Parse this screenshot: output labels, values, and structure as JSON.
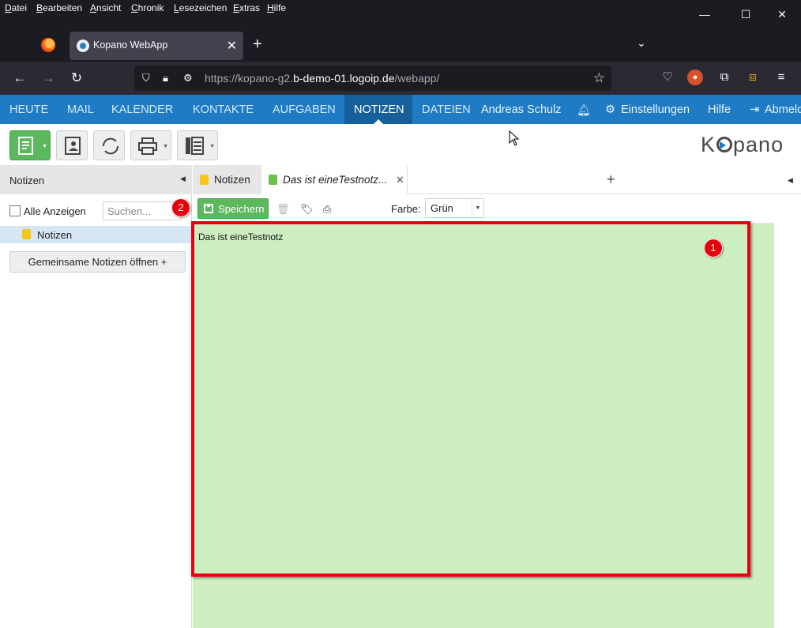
{
  "menubar": {
    "items": [
      "Datei",
      "Bearbeiten",
      "Ansicht",
      "Chronik",
      "Lesezeichen",
      "Extras",
      "Hilfe"
    ],
    "accelerators": [
      "D",
      "B",
      "A",
      "C",
      "L",
      "E",
      "H"
    ],
    "rest": [
      "atei",
      "earbeiten",
      "nsicht",
      "hronik",
      "esezeichen",
      "xtras",
      "ilfe"
    ]
  },
  "window_controls": {
    "minimize": "—",
    "maximize": "☐",
    "close": "✕"
  },
  "browser": {
    "tab_title": "Kopano WebApp",
    "tab_close": "✕",
    "new_tab": "+",
    "tab_list": "⌄",
    "url_dim_prefix": "https://kopano-g2.",
    "url_host": "b-demo-01.logoip.de",
    "url_dim_suffix": "/webapp/"
  },
  "topnav": {
    "items": [
      "HEUTE",
      "MAIL",
      "KALENDER",
      "KONTAKTE",
      "AUFGABEN",
      "NOTIZEN",
      "DATEIEN"
    ],
    "active": "NOTIZEN",
    "user": "Andreas Schulz",
    "settings": "Einstellungen",
    "help": "Hilfe",
    "logout": "Abmelden"
  },
  "logo": {
    "k": "K",
    "pano": "pano"
  },
  "sidebar": {
    "title": "Notizen",
    "show_all": "Alle Anzeigen",
    "search_placeholder": "Suchen...",
    "folder": "Notizen",
    "shared_button": "Gemeinsame Notizen öffnen +"
  },
  "content_tabs": {
    "first": "Notizen",
    "second": "Das ist eineTestnotz...",
    "close": "✕",
    "add": "+"
  },
  "editor": {
    "save": "Speichern",
    "color_label": "Farbe:",
    "color_value": "Grün",
    "note_text": "Das ist eineTestnotz"
  },
  "annotations": {
    "badge1": "1",
    "badge2": "2"
  },
  "colors": {
    "nav_blue": "#1e7bc4",
    "note_green": "#cdeec1",
    "button_green": "#5cb85c",
    "annotation_red": "#e8000d"
  }
}
